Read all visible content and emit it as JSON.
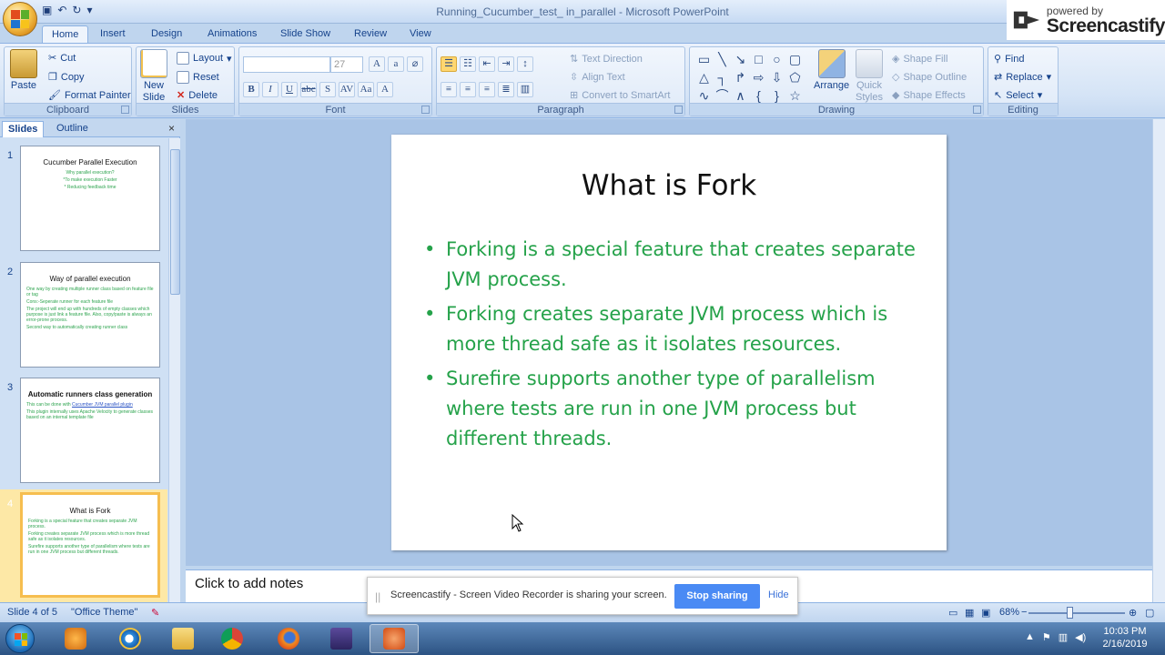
{
  "window": {
    "title": "Running_Cucumber_test_ in_parallel - Microsoft PowerPoint"
  },
  "watermark": {
    "line1": "powered by",
    "line2": "Screencastify"
  },
  "quick_access": [
    "save-icon",
    "undo-icon",
    "redo-icon",
    "customize-icon"
  ],
  "ribbon": {
    "tabs": [
      "Home",
      "Insert",
      "Design",
      "Animations",
      "Slide Show",
      "Review",
      "View"
    ],
    "active_tab": "Home",
    "clipboard": {
      "paste": "Paste",
      "cut": "Cut",
      "copy": "Copy",
      "format_painter": "Format Painter",
      "label": "Clipboard"
    },
    "slides": {
      "new_slide_1": "New",
      "new_slide_2": "Slide",
      "layout": "Layout",
      "reset": "Reset",
      "delete": "Delete",
      "label": "Slides"
    },
    "font": {
      "font_name": "",
      "font_size": "27",
      "label": "Font"
    },
    "paragraph": {
      "text_direction": "Text Direction",
      "align_text": "Align Text",
      "convert_smartart": "Convert to SmartArt",
      "label": "Paragraph"
    },
    "drawing": {
      "arrange": "Arrange",
      "quick_styles_1": "Quick",
      "quick_styles_2": "Styles",
      "shape_fill": "Shape Fill",
      "shape_outline": "Shape Outline",
      "shape_effects": "Shape Effects",
      "label": "Drawing"
    },
    "editing": {
      "find": "Find",
      "replace": "Replace",
      "select": "Select",
      "label": "Editing"
    }
  },
  "panel": {
    "tabs": [
      "Slides",
      "Outline"
    ],
    "active_tab": "Slides",
    "thumbnails": [
      {
        "num": "1",
        "title": "Cucumber Parallel Execution",
        "bullets": [
          "Why parallel execution?",
          "*To make execution Faster",
          "* Reducing feedback time"
        ]
      },
      {
        "num": "2",
        "title": "Way of parallel execution",
        "bullets": [
          "One way by creating multiple runner class based on feature file or tag",
          "Cons:-Seperate runner for each feature file",
          "The project will end up with hundreds of empty classes which purpose is just link a feature file. Also, copy/paste is always an error-prone process.",
          "Second way to automatically creating runner class"
        ]
      },
      {
        "num": "3",
        "title": "Automatic runners class generation",
        "bullet1_prefix": "This can be done with ",
        "bullet1_link": "Cucumber JVM parallel plugin",
        "bullet2": "This plugin internally uses Apache Velocity to generate classes based on an internal template file"
      },
      {
        "num": "4",
        "title": "What is Fork",
        "bullets": [
          "Forking is a special feature that creates separate JVM process.",
          "Forking creates separate JVM process which is more thread safe as it isolates resources.",
          "Surefire supports another type of parallelism where tests are run in one JVM process but different threads."
        ]
      }
    ]
  },
  "slide": {
    "title": "What is Fork",
    "bullets": [
      "Forking is a special feature that creates separate JVM process.",
      "Forking creates separate JVM process which is more thread safe as it isolates resources.",
      "Surefire supports another type of parallelism where tests are run in one JVM process but different threads."
    ]
  },
  "notes": {
    "placeholder": "Click to add notes"
  },
  "status": {
    "slide_info": "Slide 4 of 5",
    "theme": "\"Office Theme\"",
    "zoom": "68%"
  },
  "sharebar": {
    "message": "Screencastify - Screen Video Recorder is sharing your screen.",
    "stop": "Stop sharing",
    "hide": "Hide"
  },
  "taskbar": {
    "apps": [
      "media-player-icon",
      "internet-explorer-icon",
      "file-explorer-icon",
      "chrome-icon",
      "firefox-icon",
      "eclipse-icon",
      "powerpoint-icon"
    ],
    "time": "10:03 PM",
    "date": "2/16/2019"
  },
  "colors": {
    "bullet_green": "#25a24a",
    "stop_blue": "#4a8af4",
    "ribbon_text": "#15428b"
  }
}
